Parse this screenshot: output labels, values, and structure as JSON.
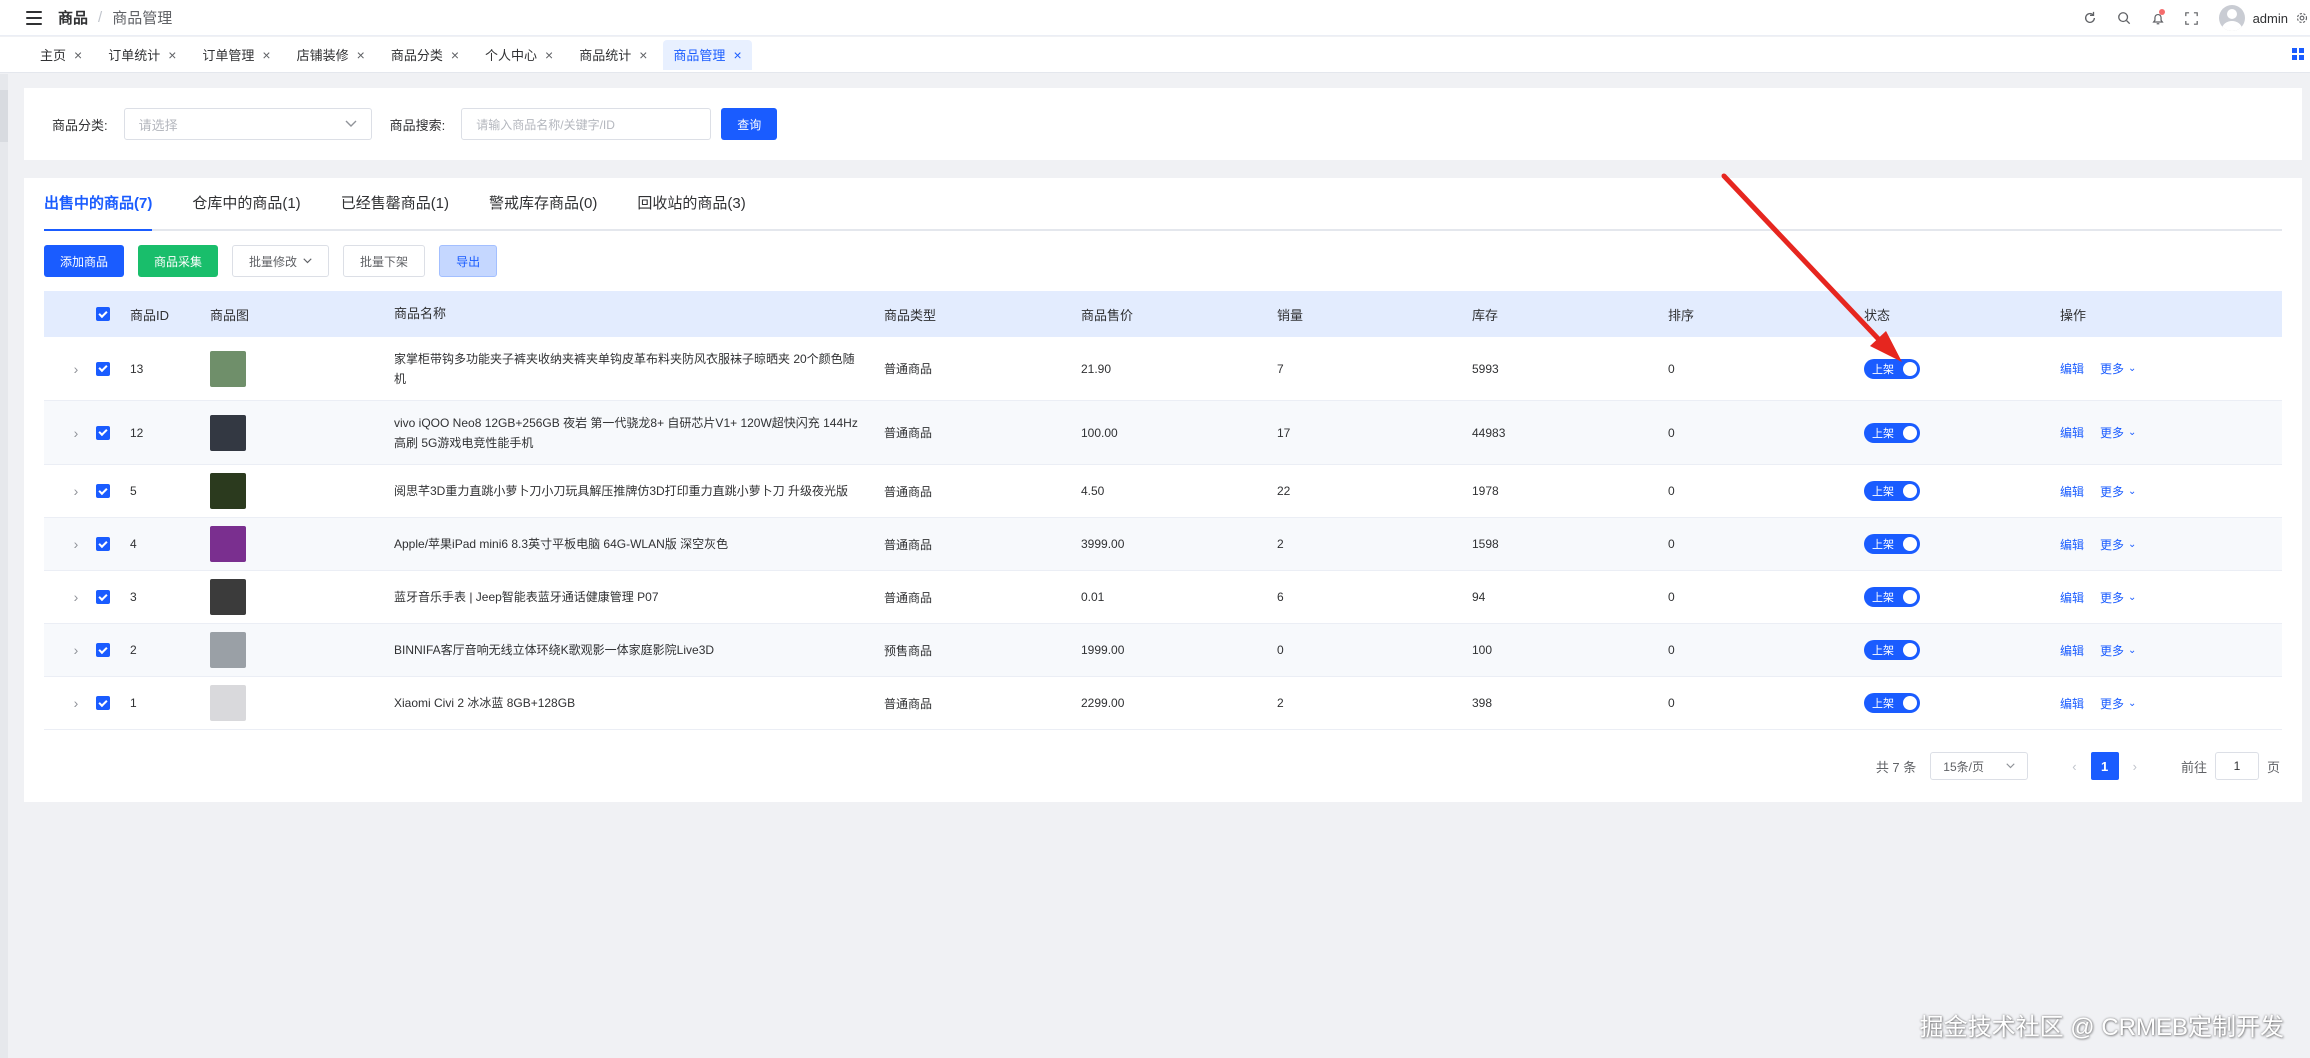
{
  "header": {
    "breadcrumb_root": "商品",
    "breadcrumb_sep": "/",
    "breadcrumb_current": "商品管理",
    "username": "admin"
  },
  "tags": [
    {
      "label": "主页",
      "active": false
    },
    {
      "label": "订单统计",
      "active": false
    },
    {
      "label": "订单管理",
      "active": false
    },
    {
      "label": "店铺装修",
      "active": false
    },
    {
      "label": "商品分类",
      "active": false
    },
    {
      "label": "个人中心",
      "active": false
    },
    {
      "label": "商品统计",
      "active": false
    },
    {
      "label": "商品管理",
      "active": true
    }
  ],
  "filter": {
    "category_label": "商品分类:",
    "category_placeholder": "请选择",
    "search_label": "商品搜索:",
    "search_placeholder": "请输入商品名称/关键字/ID",
    "query_button": "查询"
  },
  "tabs": [
    {
      "label": "出售中的商品(7)",
      "active": true
    },
    {
      "label": "仓库中的商品(1)",
      "active": false
    },
    {
      "label": "已经售罄商品(1)",
      "active": false
    },
    {
      "label": "警戒库存商品(0)",
      "active": false
    },
    {
      "label": "回收站的商品(3)",
      "active": false
    }
  ],
  "actions": {
    "add": "添加商品",
    "collect": "商品采集",
    "batch_edit": "批量修改",
    "batch_off": "批量下架",
    "export": "导出"
  },
  "table": {
    "headers": {
      "id": "商品ID",
      "img": "商品图",
      "name": "商品名称",
      "type": "商品类型",
      "price": "商品售价",
      "sales": "销量",
      "stock": "库存",
      "sort": "排序",
      "status": "状态",
      "ops": "操作"
    },
    "status_label": "上架",
    "edit_label": "编辑",
    "more_label": "更多",
    "rows": [
      {
        "id": "13",
        "name": "家掌柜带钩多功能夹子裤夹收纳夹裤夹单钩皮革布料夹防风衣服袜子晾晒夹 20个颜色随机",
        "type": "普通商品",
        "price": "21.90",
        "sales": "7",
        "stock": "5993",
        "sort": "0",
        "thumb_color": "#6f8f6a",
        "tall": true
      },
      {
        "id": "12",
        "name": "vivo iQOO Neo8 12GB+256GB 夜岩 第一代骁龙8+ 自研芯片V1+ 120W超快闪充 144Hz高刷 5G游戏电竞性能手机",
        "type": "普通商品",
        "price": "100.00",
        "sales": "17",
        "stock": "44983",
        "sort": "0",
        "thumb_color": "#333842",
        "tall": true
      },
      {
        "id": "5",
        "name": "阅思芊3D重力直跳小萝卜刀小刀玩具解压推牌仿3D打印重力直跳小萝卜刀 升级夜光版",
        "type": "普通商品",
        "price": "4.50",
        "sales": "22",
        "stock": "1978",
        "sort": "0",
        "thumb_color": "#2b3a1e",
        "tall": false
      },
      {
        "id": "4",
        "name": "Apple/苹果iPad mini6 8.3英寸平板电脑 64G-WLAN版 深空灰色",
        "type": "普通商品",
        "price": "3999.00",
        "sales": "2",
        "stock": "1598",
        "sort": "0",
        "thumb_color": "#7a2f8f",
        "tall": false
      },
      {
        "id": "3",
        "name": "蓝牙音乐手表 | Jeep智能表蓝牙通话健康管理 P07",
        "type": "普通商品",
        "price": "0.01",
        "sales": "6",
        "stock": "94",
        "sort": "0",
        "thumb_color": "#3b3b3b",
        "tall": false
      },
      {
        "id": "2",
        "name": "BINNIFA客厅音响无线立体环绕K歌观影一体家庭影院Live3D",
        "type": "预售商品",
        "price": "1999.00",
        "sales": "0",
        "stock": "100",
        "sort": "0",
        "thumb_color": "#9aa0a6",
        "tall": false
      },
      {
        "id": "1",
        "name": "Xiaomi Civi 2 冰冰蓝 8GB+128GB",
        "type": "普通商品",
        "price": "2299.00",
        "sales": "2",
        "stock": "398",
        "sort": "0",
        "thumb_color": "#d9d9dc",
        "tall": false
      }
    ]
  },
  "pagination": {
    "total": "共 7 条",
    "page_size": "15条/页",
    "current_page": "1",
    "goto_label": "前往",
    "goto_value": "1",
    "page_unit": "页"
  },
  "watermark": "掘金技术社区 @ CRMEB定制开发",
  "colors": {
    "primary": "#1a5cff",
    "success": "#19be6b",
    "annotation_arrow": "#e6261f"
  }
}
